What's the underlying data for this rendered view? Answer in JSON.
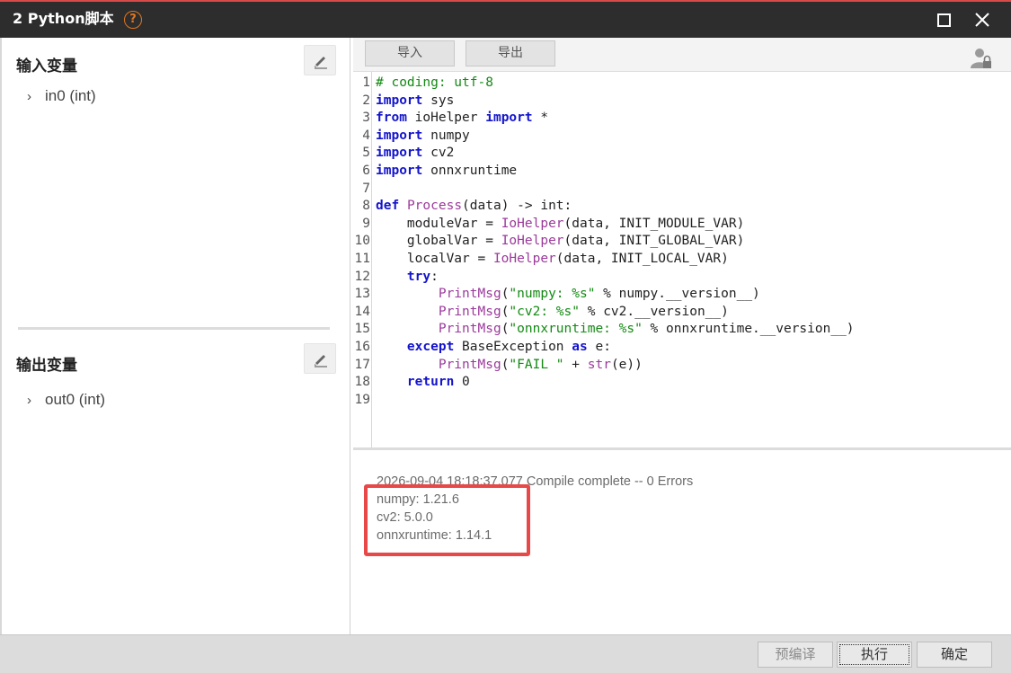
{
  "window": {
    "title": "2 Python脚本",
    "help_icon": "?"
  },
  "left": {
    "input_title": "输入变量",
    "input_vars": [
      {
        "label": "in0 (int)"
      }
    ],
    "output_title": "输出变量",
    "output_vars": [
      {
        "label": "out0 (int)"
      }
    ]
  },
  "toolbar": {
    "import_label": "导入",
    "export_label": "导出"
  },
  "code_lines": [
    "# coding: utf-8",
    "import sys",
    "from ioHelper import *",
    "import numpy",
    "import cv2",
    "import onnxruntime",
    "",
    "def Process(data) -> int:",
    "    moduleVar = IoHelper(data, INIT_MODULE_VAR)",
    "    globalVar = IoHelper(data, INIT_GLOBAL_VAR)",
    "    localVar = IoHelper(data, INIT_LOCAL_VAR)",
    "    try:",
    "        PrintMsg(\"numpy: %s\" % numpy.__version__)",
    "        PrintMsg(\"cv2: %s\" % cv2.__version__)",
    "        PrintMsg(\"onnxruntime: %s\" % onnxruntime.__version__)",
    "    except BaseException as e:",
    "        PrintMsg(\"FAIL \" + str(e))",
    "    return 0",
    ""
  ],
  "output": {
    "compile_line": "2026-09-04 18:18:37.077 Compile complete -- 0 Errors",
    "messages": [
      "numpy: 1.21.6",
      "cv2: 5.0.0",
      "onnxruntime: 1.14.1"
    ]
  },
  "footer": {
    "precompile_label": "预编译",
    "run_label": "执行",
    "ok_label": "确定"
  },
  "colors": {
    "titlebar": "#2d2d2d",
    "highlight": "#e84848",
    "keyword": "#1414cc",
    "string": "#138a13",
    "function": "#9b3a9b"
  }
}
